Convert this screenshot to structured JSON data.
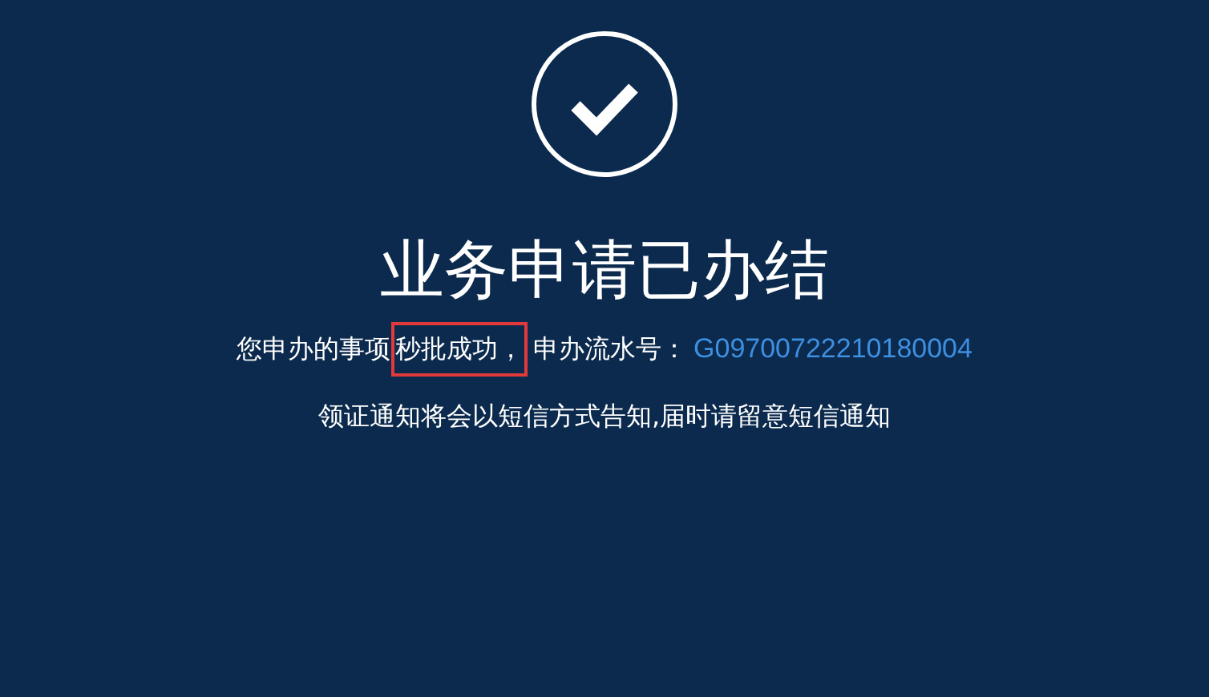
{
  "result": {
    "title": "业务申请已办结",
    "message_prefix": "您申办的事项",
    "message_highlight": "秒批成功，",
    "serial_label": "申办流水号：",
    "serial_number": "G09700722210180004",
    "notice": "领证通知将会以短信方式告知,届时请留意短信通知"
  }
}
